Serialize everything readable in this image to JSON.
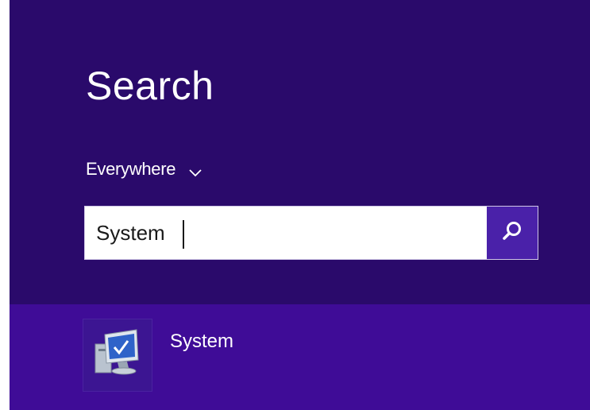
{
  "colors": {
    "pane_background": "#2a0a6b",
    "results_background": "#3f0c97",
    "search_button": "#4a21a9",
    "text": "#ffffff"
  },
  "search_pane": {
    "title": "Search",
    "scope": {
      "label": "Everywhere",
      "icon": "chevron-down-icon"
    },
    "search_box": {
      "value": "System",
      "button_icon": "magnifier-icon"
    }
  },
  "results": [
    {
      "label": "System",
      "icon": "computer-system-icon"
    }
  ]
}
